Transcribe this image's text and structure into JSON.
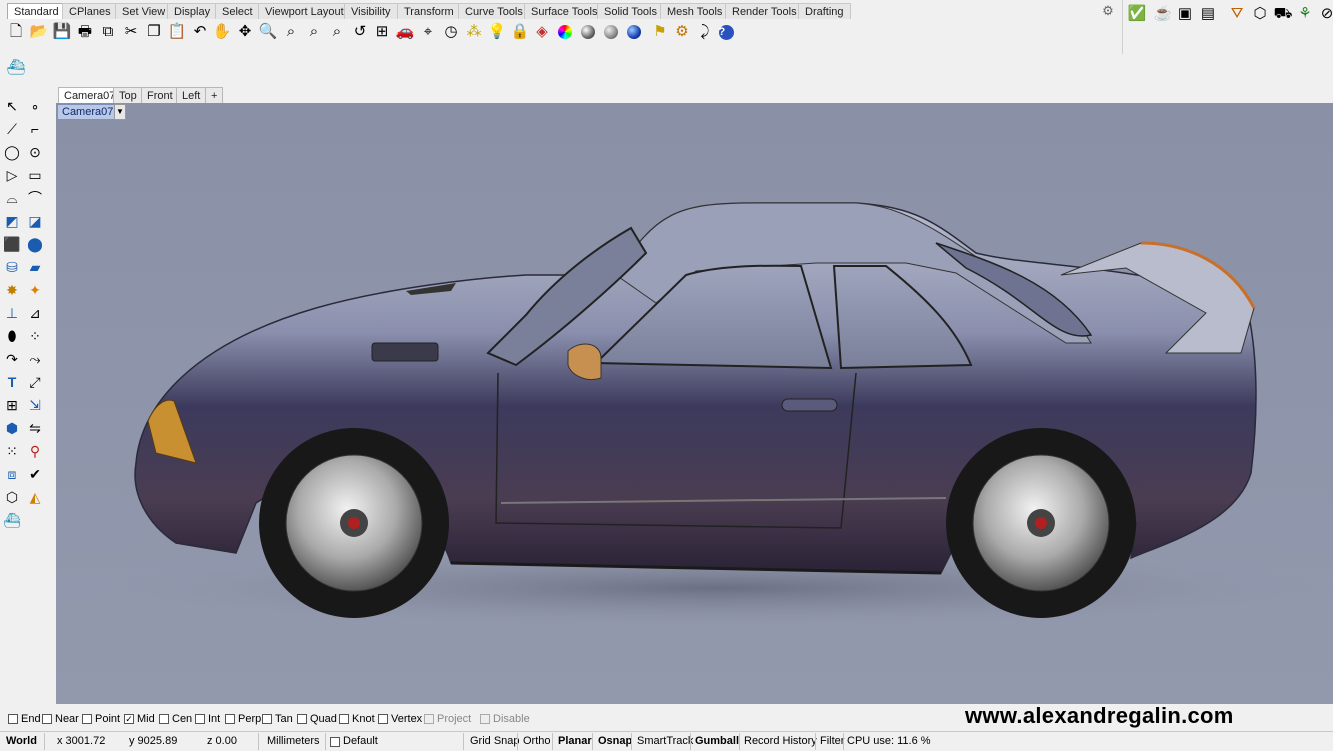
{
  "top_tabs": [
    "Standard",
    "CPlanes",
    "Set View",
    "Display",
    "Select",
    "Viewport Layout",
    "Visibility",
    "Transform",
    "Curve Tools",
    "Surface Tools",
    "Solid Tools",
    "Mesh Tools",
    "Render Tools",
    "Drafting"
  ],
  "active_top_tab": "Standard",
  "viewport_tabs": [
    "Camera07",
    "Top",
    "Front",
    "Left"
  ],
  "viewport_add": "+",
  "viewport_label": "Camera07",
  "osnaps": [
    {
      "label": "End",
      "checked": false
    },
    {
      "label": "Near",
      "checked": false
    },
    {
      "label": "Point",
      "checked": false
    },
    {
      "label": "Mid",
      "checked": true
    },
    {
      "label": "Cen",
      "checked": false
    },
    {
      "label": "Int",
      "checked": false
    },
    {
      "label": "Perp",
      "checked": false
    },
    {
      "label": "Tan",
      "checked": false
    },
    {
      "label": "Quad",
      "checked": false
    },
    {
      "label": "Knot",
      "checked": false
    },
    {
      "label": "Vertex",
      "checked": false
    },
    {
      "label": "Project",
      "checked": false,
      "disabled": true
    },
    {
      "label": "Disable",
      "checked": false,
      "disabled": true
    }
  ],
  "watermark": "www.alexandregalin.com",
  "status": {
    "cplane": "World",
    "x": "x 3001.72",
    "y": "y 9025.89",
    "z": "z 0.00",
    "units": "Millimeters",
    "layer": "Default",
    "grid_snap": "Grid Snap",
    "ortho": "Ortho",
    "planar": "Planar",
    "osnap": "Osnap",
    "smarttrack": "SmartTrack",
    "gumball": "Gumball",
    "record_history": "Record History",
    "filter": "Filter",
    "cpu": "CPU use: 11.6 %"
  }
}
